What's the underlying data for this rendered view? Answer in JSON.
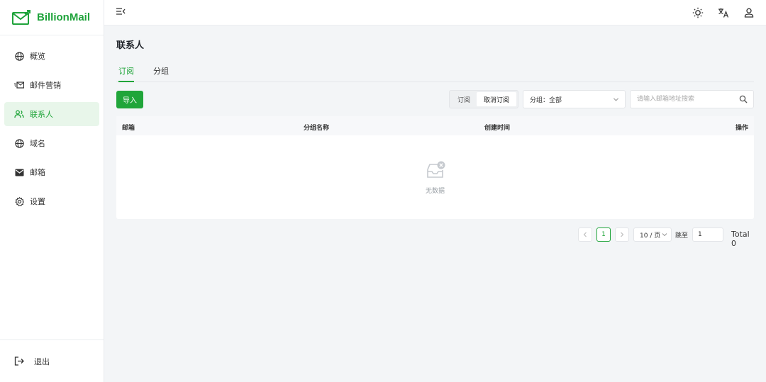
{
  "brand": {
    "name": "BillionMail",
    "color": "#1fa33b"
  },
  "sidebar": {
    "items": [
      {
        "label": "概览",
        "icon": "globe-icon",
        "active": false
      },
      {
        "label": "邮件营销",
        "icon": "mail-send-icon",
        "active": false
      },
      {
        "label": "联系人",
        "icon": "users-icon",
        "active": true
      },
      {
        "label": "域名",
        "icon": "globe-icon",
        "active": false
      },
      {
        "label": "邮箱",
        "icon": "envelope-icon",
        "active": false
      },
      {
        "label": "设置",
        "icon": "gear-icon",
        "active": false
      }
    ],
    "logout_label": "退出"
  },
  "header": {
    "collapse_icon": "menu-collapse-icon",
    "theme_icon": "sun-icon",
    "language_icon": "translate-icon",
    "user_icon": "user-icon"
  },
  "page": {
    "title": "联系人",
    "tabs": [
      {
        "label": "订阅",
        "active": true
      },
      {
        "label": "分组",
        "active": false
      }
    ]
  },
  "toolbar": {
    "import_label": "导入",
    "segment": {
      "options": [
        "订阅",
        "取消订阅"
      ],
      "selected": "取消订阅"
    },
    "group_select": {
      "value": "分组：全部"
    },
    "search": {
      "placeholder": "请输入邮箱地址搜索",
      "value": ""
    }
  },
  "table": {
    "columns": [
      "邮箱",
      "分组名称",
      "创建时间",
      "操作"
    ],
    "rows": [],
    "empty_text": "无数据"
  },
  "pagination": {
    "current_page": "1",
    "page_size": "10 / 页",
    "goto_label": "跳至",
    "goto_value": "1",
    "total_label": "Total 0"
  },
  "colors": {
    "accent": "#20a53a",
    "active_bg": "#e8f6ea",
    "page_bg": "#f3f5f7"
  }
}
